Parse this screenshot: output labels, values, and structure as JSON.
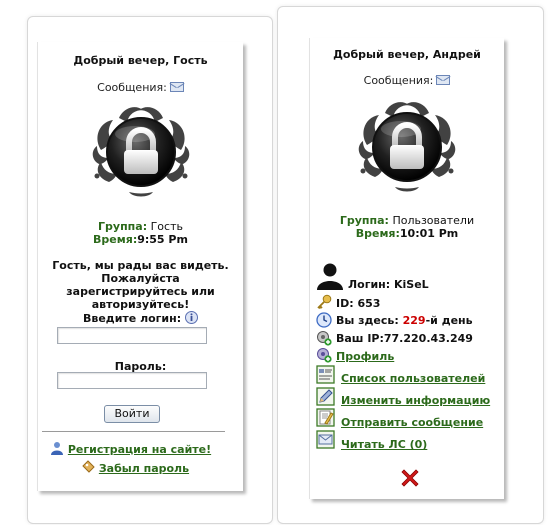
{
  "guest_panel": {
    "greeting": "Добрый вечер, Гость",
    "messages_label": "Сообщения:",
    "group_label": "Группа:",
    "group_value": "Гость",
    "time_label": "Время:",
    "time_value": "9:55 Pm",
    "welcome_line1": "Гость, мы рады вас видеть.",
    "welcome_line2": "Пожалуйста",
    "welcome_line3": "зарегистрируйтесь или",
    "welcome_line4": "авторизуйтесь!",
    "login_label": "Введите логин:",
    "login_value": "",
    "password_label": "Пароль:",
    "password_value": "",
    "submit_label": "Войти",
    "register_link": "Регистрация на сайте!",
    "forgot_link": "Забыл пароль"
  },
  "user_panel": {
    "greeting": "Добрый вечер, Андрей",
    "messages_label": "Сообщения:",
    "group_label": "Группа:",
    "group_value": "Пользователи",
    "time_label": "Время:",
    "time_value": "10:01 Pm",
    "login_label": "Логин:",
    "login_value": "KiSeL",
    "id_label": "ID:",
    "id_value": "653",
    "days_prefix": "Вы здесь:",
    "days_value": "229",
    "days_suffix": "-й день",
    "ip_label": "Ваш IP:",
    "ip_value": "77.220.43.249",
    "menu": [
      {
        "label": "Профиль",
        "icon": "profile-icon"
      },
      {
        "label": "Список пользователей",
        "icon": "user-list-icon"
      },
      {
        "label": "Изменить информацию",
        "icon": "edit-info-icon"
      },
      {
        "label": "Отправить сообщение",
        "icon": "send-message-icon"
      },
      {
        "label": "Читать ЛС (0)",
        "icon": "read-messages-icon"
      }
    ],
    "logout_icon": "red-x-icon"
  },
  "colors": {
    "accent_green": "#2c6a1b",
    "days_red": "#cc0000",
    "logout_red": "#d11a1a"
  }
}
